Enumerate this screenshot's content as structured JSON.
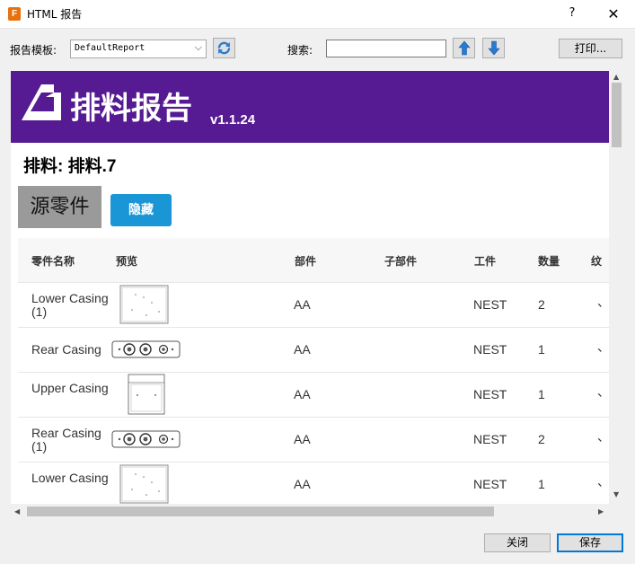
{
  "window": {
    "title": "HTML 报告",
    "app_icon_letter": "F",
    "help": "?",
    "close": "✕"
  },
  "toolbar": {
    "template_label": "报告模板:",
    "template_value": "DefaultReport",
    "search_label": "搜索:",
    "search_value": "",
    "print_label": "打印..."
  },
  "report": {
    "title": "排料报告",
    "version": "v1.1.24",
    "nest_title": "排料: 排料.7",
    "section_label": "源零件",
    "hide_label": "隐藏",
    "columns": [
      "零件名称",
      "预览",
      "部件",
      "子部件",
      "工件",
      "数量",
      "纹"
    ],
    "rows": [
      {
        "name": "Lower Casing (1)",
        "preview": "box",
        "part": "AA",
        "subpart": "",
        "work": "NEST",
        "qty": "2",
        "more": "、"
      },
      {
        "name": "Rear Casing",
        "preview": "rail",
        "part": "AA",
        "subpart": "",
        "work": "NEST",
        "qty": "1",
        "more": "、"
      },
      {
        "name": "Upper Casing",
        "preview": "upper",
        "part": "AA",
        "subpart": "",
        "work": "NEST",
        "qty": "1",
        "more": "、"
      },
      {
        "name": "Rear Casing (1)",
        "preview": "rail",
        "part": "AA",
        "subpart": "",
        "work": "NEST",
        "qty": "2",
        "more": "、"
      },
      {
        "name": "Lower Casing",
        "preview": "box",
        "part": "AA",
        "subpart": "",
        "work": "NEST",
        "qty": "1",
        "more": "、"
      }
    ]
  },
  "footer": {
    "close_label": "关闭",
    "save_label": "保存"
  },
  "colors": {
    "banner": "#561b92",
    "hide_button": "#1a96d6",
    "arrow_button": "#2a7ad0"
  }
}
